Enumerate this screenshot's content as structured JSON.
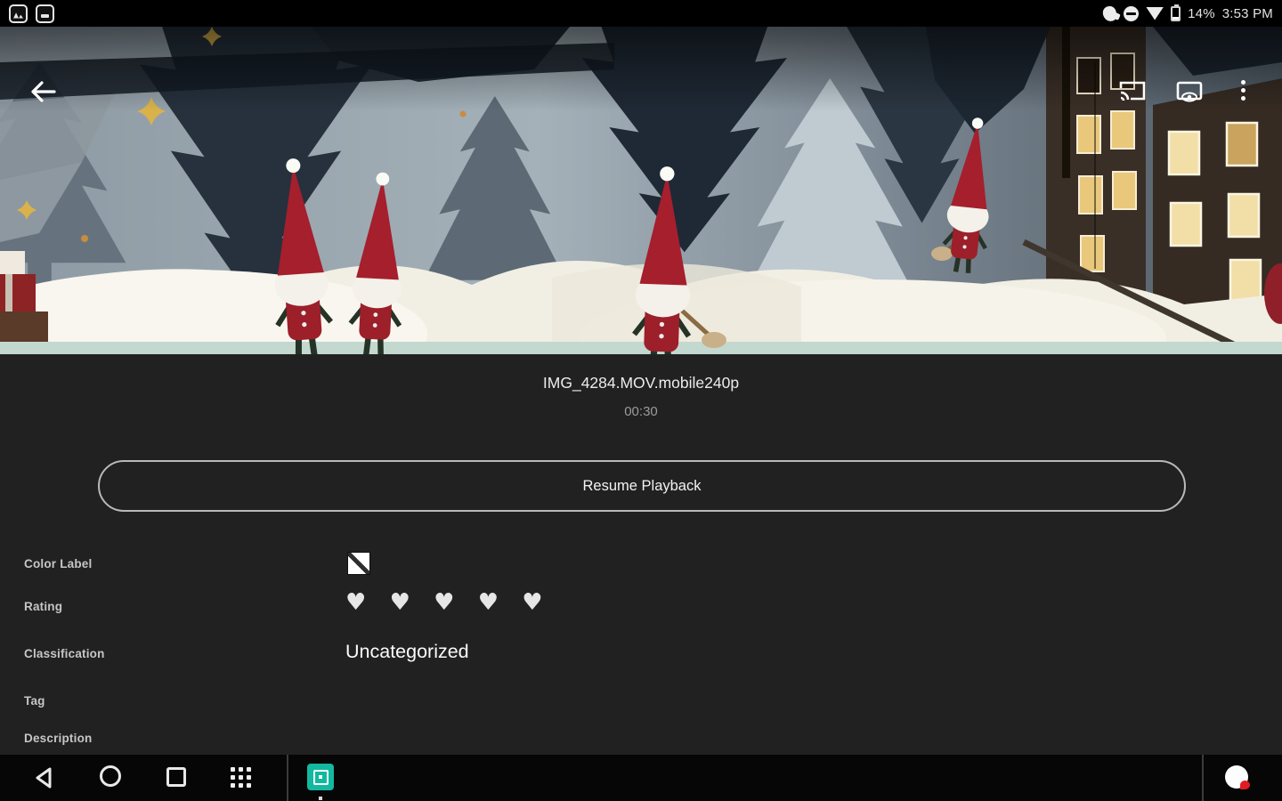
{
  "status_bar": {
    "time": "3:53 PM",
    "battery_percent": "14%",
    "notification_icons": [
      "photo-notification-icon",
      "media-notification-icon"
    ],
    "system_icons": [
      "hand-gesture-icon",
      "do-not-disturb-icon",
      "wifi-icon",
      "battery-low-icon"
    ]
  },
  "video": {
    "title": "IMG_4284.MOV.mobile240p",
    "duration": "00:30",
    "resume_button_label": "Resume Playback",
    "overlay_icons": [
      "back-arrow-icon",
      "cast-icon",
      "screen-preview-eye-icon",
      "overflow-menu-icon"
    ],
    "scene_description": "christmas gnomes with red hats on snow among paper cut-out trees and houses"
  },
  "metadata": {
    "rows": [
      {
        "label": "Color Label",
        "value_icon": "no-color-label-icon"
      },
      {
        "label": "Rating",
        "hearts": "♥ ♥ ♥ ♥ ♥",
        "rating_max": 5,
        "rating_value": 5
      },
      {
        "label": "Classification",
        "value": "Uncategorized"
      },
      {
        "label": "Tag",
        "value": ""
      },
      {
        "label": "Description",
        "value": ""
      }
    ]
  },
  "nav_bar": {
    "icons": [
      "back-nav-icon",
      "home-nav-icon",
      "recents-nav-icon",
      "app-grid-icon",
      "gallery-app-icon",
      "floating-record-icon"
    ]
  },
  "colors": {
    "accent_teal": "#12b8a0",
    "panel_bg": "#212121",
    "button_border": "#b9b9b9",
    "duration_text": "#9b9b9b",
    "heart": "#e6e6e6",
    "badge_red": "#e01b24"
  }
}
